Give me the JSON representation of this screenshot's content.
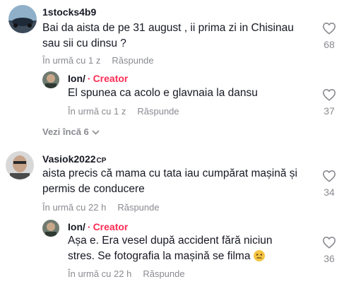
{
  "comments": [
    {
      "username": "1stocks4b9",
      "text": "Bai da aista de pe 31 august , ii prima zi in Chisinau sau sii cu dinsu ?",
      "time": "În urmă cu 1 z",
      "reply": "Răspunde",
      "likes": "68"
    },
    {
      "username": "Ion/",
      "creator": "Creator",
      "text": "El spunea ca acolo e glavnaia la dansu",
      "time": "În urmă cu 1 z",
      "reply": "Răspunde",
      "likes": "37"
    },
    {
      "username": "Vasiok2022",
      "badge": "CP",
      "text": "aista precis că mama cu tata iau cumpărat mașină și permis de conducere",
      "time": "În urmă cu 22 h",
      "reply": "Răspunde",
      "likes": "34"
    },
    {
      "username": "Ion/",
      "creator": "Creator",
      "text": "Așa e. Era vesel după accident fără niciun stres. Se fotografia la mașină se filma",
      "time": "În urmă cu 22 h",
      "reply": "Răspunde",
      "likes": "36"
    }
  ],
  "view_more": "Vezi încă 6",
  "icons": {
    "like": "heart-outline-icon",
    "chevron": "chevron-down-icon",
    "emoji": "confounded-face-emoji"
  },
  "colors": {
    "creator": "#fe2c55",
    "meta": "#8a8b91",
    "text": "#161823"
  }
}
